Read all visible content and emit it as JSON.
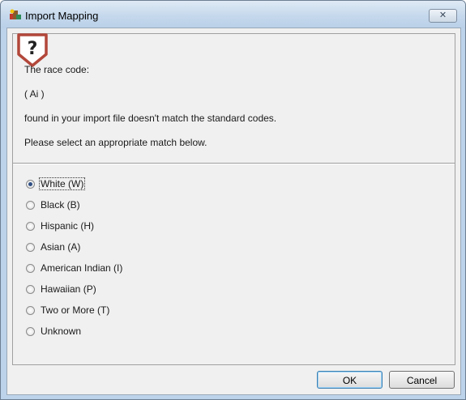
{
  "window": {
    "title": "Import Mapping",
    "close_glyph": "✕"
  },
  "help_icon": {
    "glyph": "?"
  },
  "message": {
    "line1": "The race code:",
    "code": "( Ai )",
    "line2": "found in your import file doesn't match the standard codes.",
    "line3": "Please select an appropriate match below."
  },
  "options": [
    {
      "label": "White (W)",
      "checked": true
    },
    {
      "label": "Black (B)",
      "checked": false
    },
    {
      "label": "Hispanic (H)",
      "checked": false
    },
    {
      "label": "Asian (A)",
      "checked": false
    },
    {
      "label": "American Indian (I)",
      "checked": false
    },
    {
      "label": "Hawaiian (P)",
      "checked": false
    },
    {
      "label": "Two or More (T)",
      "checked": false
    },
    {
      "label": "Unknown",
      "checked": false
    }
  ],
  "buttons": {
    "ok": "OK",
    "cancel": "Cancel"
  }
}
